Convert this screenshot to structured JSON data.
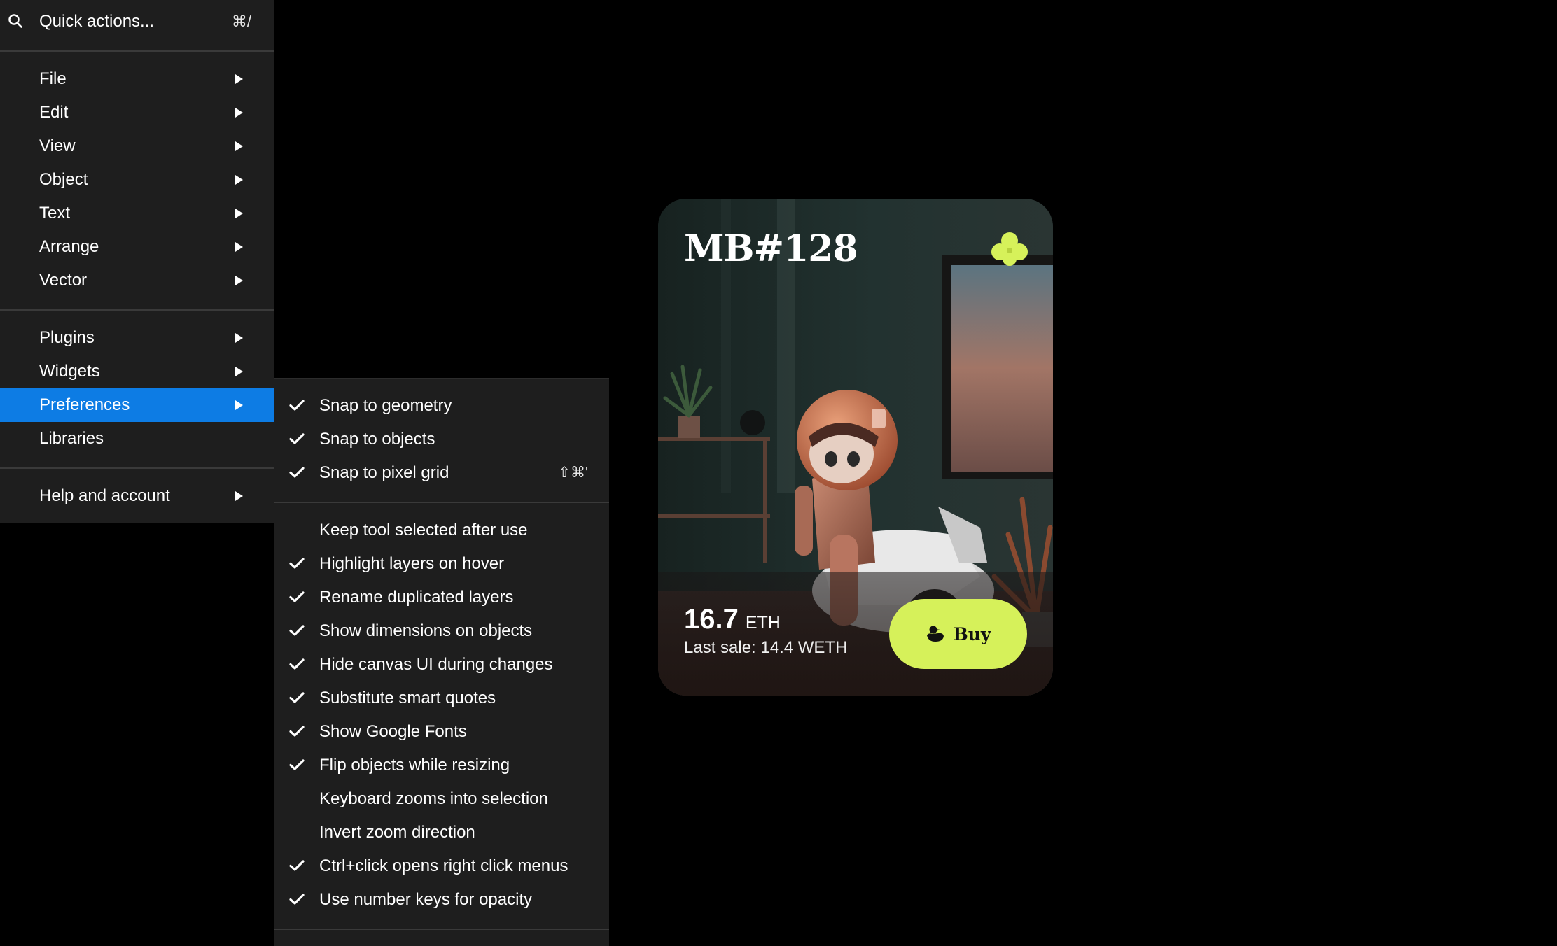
{
  "quick_actions": {
    "label": "Quick actions...",
    "shortcut": "⌘/"
  },
  "main_menu": {
    "items": [
      {
        "label": "File",
        "has_submenu": true
      },
      {
        "label": "Edit",
        "has_submenu": true
      },
      {
        "label": "View",
        "has_submenu": true
      },
      {
        "label": "Object",
        "has_submenu": true
      },
      {
        "label": "Text",
        "has_submenu": true
      },
      {
        "label": "Arrange",
        "has_submenu": true
      },
      {
        "label": "Vector",
        "has_submenu": true
      },
      {
        "label": "Plugins",
        "has_submenu": true
      },
      {
        "label": "Widgets",
        "has_submenu": true
      },
      {
        "label": "Preferences",
        "has_submenu": true,
        "active": true
      },
      {
        "label": "Libraries",
        "has_submenu": false
      },
      {
        "label": "Help and account",
        "has_submenu": true
      }
    ]
  },
  "preferences_menu": {
    "items": [
      {
        "label": "Snap to geometry",
        "checked": true,
        "shortcut": ""
      },
      {
        "label": "Snap to objects",
        "checked": true,
        "shortcut": ""
      },
      {
        "label": "Snap to pixel grid",
        "checked": true,
        "shortcut": "⇧⌘'"
      },
      {
        "label": "Keep tool selected after use",
        "checked": false,
        "shortcut": ""
      },
      {
        "label": "Highlight layers on hover",
        "checked": true,
        "shortcut": ""
      },
      {
        "label": "Rename duplicated layers",
        "checked": true,
        "shortcut": ""
      },
      {
        "label": "Show dimensions on objects",
        "checked": true,
        "shortcut": ""
      },
      {
        "label": "Hide canvas UI during changes",
        "checked": true,
        "shortcut": ""
      },
      {
        "label": "Substitute smart quotes",
        "checked": true,
        "shortcut": ""
      },
      {
        "label": "Show Google Fonts",
        "checked": true,
        "shortcut": ""
      },
      {
        "label": "Flip objects while resizing",
        "checked": true,
        "shortcut": ""
      },
      {
        "label": "Keyboard zooms into selection",
        "checked": false,
        "shortcut": ""
      },
      {
        "label": "Invert zoom direction",
        "checked": false,
        "shortcut": ""
      },
      {
        "label": "Ctrl+click opens right click menus",
        "checked": true,
        "shortcut": ""
      },
      {
        "label": "Use number keys for opacity",
        "checked": true,
        "shortcut": ""
      }
    ]
  },
  "nft_card": {
    "title": "MB#128",
    "price_amount": "16.7",
    "price_unit": "ETH",
    "last_sale": "Last sale: 14.4 WETH",
    "buy_label": "Buy",
    "accent_color": "#d6f15a",
    "clover_icon": "clover-icon",
    "buy_icon": "duck-icon"
  },
  "colors": {
    "menu_bg": "#1e1e1e",
    "active_item": "#0d7ce4",
    "separator": "#3a3a3a",
    "canvas_bg": "#000000"
  }
}
